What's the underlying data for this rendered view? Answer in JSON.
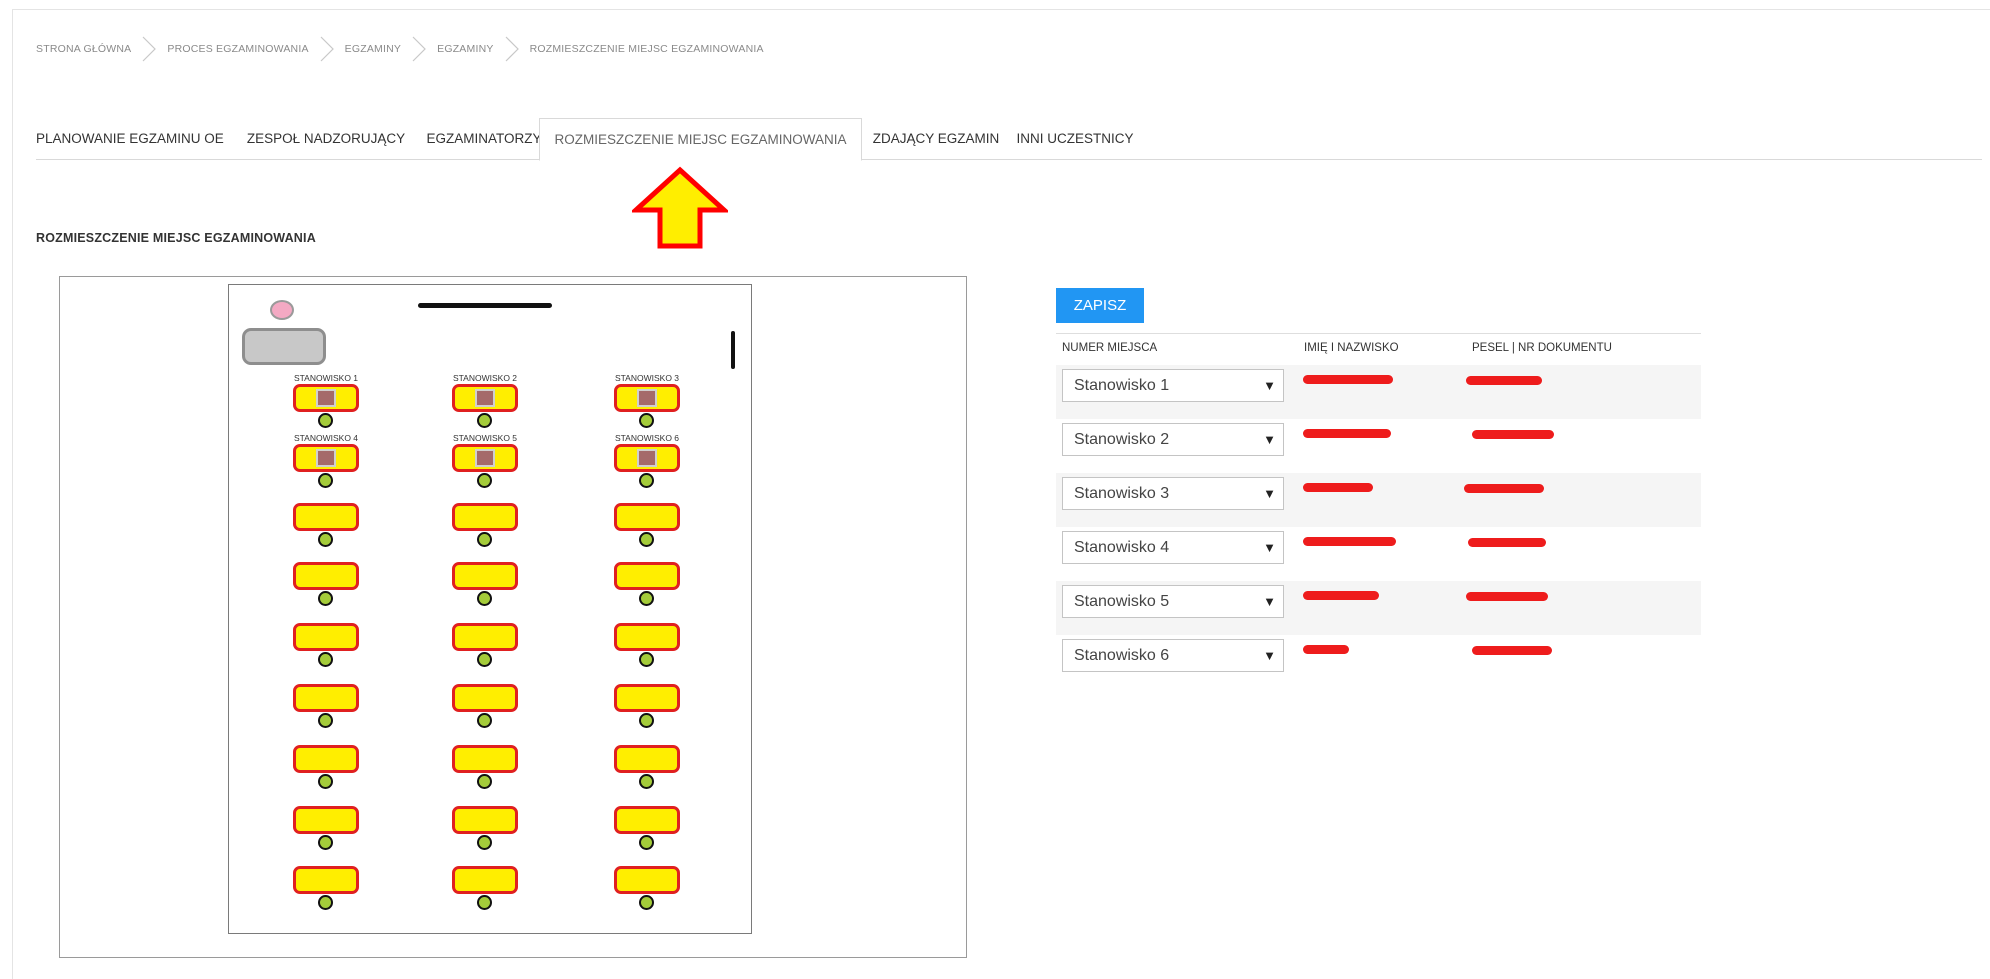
{
  "breadcrumb": [
    "STRONA GŁÓWNA",
    "PROCES EGZAMINOWANIA",
    "EGZAMINY",
    "EGZAMINY",
    "ROZMIESZCZENIE MIEJSC EGZAMINOWANIA"
  ],
  "tabs": [
    {
      "label": "PLANOWANIE EGZAMINU OE",
      "active": false
    },
    {
      "label": "ZESPOŁ NADZORUJĄCY",
      "active": false
    },
    {
      "label": "EGZAMINATORZY",
      "active": false
    },
    {
      "label": "ROZMIESZCZENIE MIEJSC EGZAMINOWANIA",
      "active": true
    },
    {
      "label": "ZDAJĄCY EGZAMIN",
      "active": false
    },
    {
      "label": "INNI UCZESTNICY",
      "active": false
    }
  ],
  "section_title": "ROZMIESZCZENIE MIEJSC EGZAMINOWANIA",
  "room": {
    "station_labels": [
      "STANOWISKO 1",
      "STANOWISKO 2",
      "STANOWISKO 3",
      "STANOWISKO 4",
      "STANOWISKO 5",
      "STANOWISKO 6"
    ]
  },
  "toolbar": {
    "save_label": "ZAPISZ"
  },
  "table": {
    "columns": [
      "NUMER MIEJSCA",
      "IMIĘ I NAZWISKO",
      "PESEL | NR DOKUMENTU"
    ],
    "rows": [
      {
        "seat": "Stanowisko 1"
      },
      {
        "seat": "Stanowisko 2"
      },
      {
        "seat": "Stanowisko 3"
      },
      {
        "seat": "Stanowisko 4"
      },
      {
        "seat": "Stanowisko 5"
      },
      {
        "seat": "Stanowisko 6"
      }
    ]
  },
  "colors": {
    "accent": "#2196f3",
    "desk_fill": "#ffee00",
    "desk_border": "#e02020",
    "chair_fill": "#a4cc3a",
    "annotation_arrow": "#ff0000",
    "redaction": "#ee1c1c"
  },
  "icons": {
    "breadcrumb_separator": "chevron-right-icon",
    "select_caret": "caret-down-icon",
    "annotation": "arrow-up-icon"
  }
}
